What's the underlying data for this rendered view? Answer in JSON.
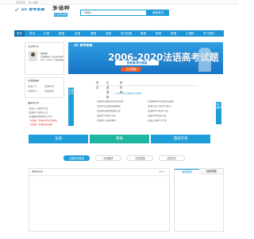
{
  "topbar": {
    "link1": "设为首页",
    "link2": "加入收藏"
  },
  "header": {
    "logo_text": "ZS 智考答题",
    "brand_title": "多语种",
    "brand_tag": "外语考试网"
  },
  "search": {
    "placeholder": "请输入",
    "button": "搜索考试"
  },
  "nav": {
    "items": [
      "首页",
      "考试",
      "日语",
      "韩语",
      "法语",
      "德语",
      "西语",
      "意大利语",
      "葡语",
      "俄语",
      "阿语",
      "小语种",
      "学习资料",
      "课程"
    ]
  },
  "teacher": {
    "heading": "法语考试",
    "name": "秦老师",
    "line1": "法语翻译 从业多年教学经验",
    "line2": "QQ：6147 | 在线答疑"
  },
  "quick": {
    "title": "快速通道",
    "links": [
      "法语入门",
      "法语考试",
      "法语学习",
      "法语资料"
    ]
  },
  "latest": {
    "title": "最新资讯",
    "items": [
      "法语入门教学方法",
      "法语学习资料汇总",
      "法语翻译经验技巧分享",
      "【法语】法语写作高分模板",
      "【法语】法语阅读真题"
    ]
  },
  "banner": {
    "logo": "ZS 智考答题",
    "title": "2006-2020法语高考试题",
    "subtitle": "含考纲/评分标准",
    "cta": "点击获取"
  },
  "tabs": {
    "items": [
      "考试",
      "法语课程",
      "资料库"
    ]
  },
  "info": {
    "title": "2021年法语考试资料",
    "items": [
      "·法语考试报名时间及安排",
      "·法语等级考试试题及答案",
      "·法语专业四级真题解析",
      "·法语专业八级听力练习",
      "·法语考试备考经验汇总",
      "·法语DELF考试介绍",
      "·法语TCF考试介绍",
      "·法语TEF考试介绍",
      "·法语学习资料推荐",
      "·法语口语学习方法"
    ]
  },
  "side_tabs": {
    "left": "法语资讯",
    "right": "热门推荐"
  },
  "languages": {
    "items": [
      "法语",
      "德语",
      "西班牙语"
    ]
  },
  "resources": {
    "items": [
      "法语资料集锦",
      "法语备考",
      "法语真题",
      "法语词汇"
    ]
  },
  "free_panel": {
    "title": "免费试听",
    "more": "更多 >"
  },
  "right_tabs": {
    "items": [
      "课程推荐",
      "最新课程"
    ]
  },
  "colors": {
    "primary": "#1f9dd8",
    "nav": "#1e95d4",
    "accent": "#f05a28"
  }
}
